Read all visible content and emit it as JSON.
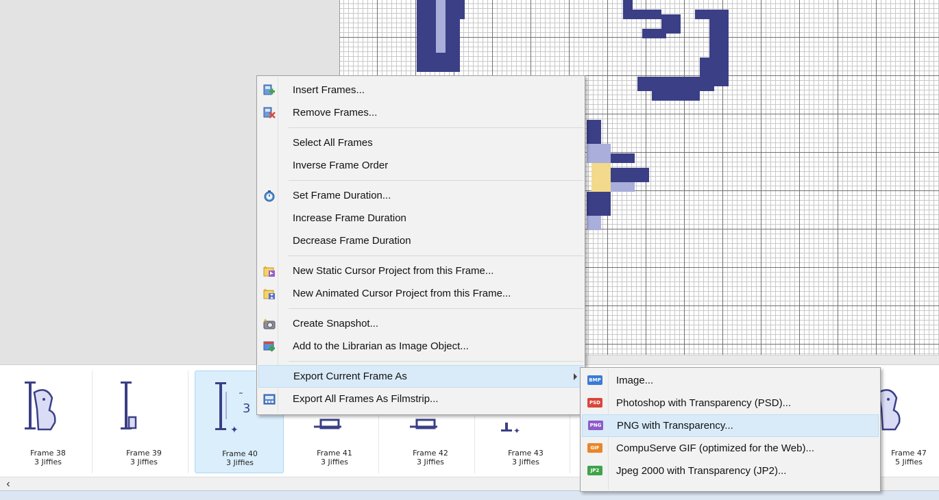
{
  "filmstrip": {
    "frames": [
      {
        "name": "Frame 38",
        "duration": "3 Jiffies"
      },
      {
        "name": "Frame 39",
        "duration": "3 Jiffies"
      },
      {
        "name": "Frame 40",
        "duration": "3 Jiffies"
      },
      {
        "name": "Frame 41",
        "duration": "3 Jiffies"
      },
      {
        "name": "Frame 42",
        "duration": "3 Jiffies"
      },
      {
        "name": "Frame 43",
        "duration": "3 Jiffies"
      },
      {
        "name": "Frame 47",
        "duration": "5 Jiffies"
      }
    ],
    "selected_frame": "Frame 40",
    "scroll_left_icon": "chevron-left-icon"
  },
  "context_menu": {
    "items": [
      {
        "label": "Insert Frames...",
        "icon": "insert-frames-icon"
      },
      {
        "label": "Remove Frames...",
        "icon": "remove-frames-icon"
      },
      {
        "label": "Select All Frames"
      },
      {
        "label": "Inverse Frame Order"
      },
      {
        "label": "Set Frame Duration...",
        "icon": "stopwatch-icon"
      },
      {
        "label": "Increase Frame Duration"
      },
      {
        "label": "Decrease Frame Duration"
      },
      {
        "label": "New Static Cursor Project from this Frame...",
        "icon": "new-static-cursor-icon"
      },
      {
        "label": "New Animated Cursor Project from this Frame...",
        "icon": "new-animated-cursor-icon"
      },
      {
        "label": "Create Snapshot...",
        "icon": "camera-icon"
      },
      {
        "label": "Add to the Librarian as Image Object...",
        "icon": "librarian-add-icon"
      },
      {
        "label": "Export Current Frame As",
        "highlighted": true
      },
      {
        "label": "Export All Frames As Filmstrip...",
        "icon": "filmstrip-icon"
      }
    ]
  },
  "export_submenu": {
    "items": [
      {
        "badge": "BMP",
        "label": "Image...",
        "color": "#3a7bd5"
      },
      {
        "badge": "PSD",
        "label": "Photoshop with Transparency (PSD)...",
        "color": "#d9463b"
      },
      {
        "badge": "PNG",
        "label": "PNG with Transparency...",
        "color": "#8e5bc9",
        "highlighted": true
      },
      {
        "badge": "GIF",
        "label": "CompuServe GIF (optimized for the Web)...",
        "color": "#e8862a"
      },
      {
        "badge": "JP2",
        "label": "Jpeg 2000 with Transparency (JP2)...",
        "color": "#3fa34a"
      }
    ]
  },
  "colors": {
    "pixel_ink": "#3b3f86",
    "pixel_shade": "#a9aedb",
    "pixel_highlight": "#f3d98b",
    "selection_bg": "#dbeefb",
    "menu_highlight": "#d9ebf9"
  }
}
